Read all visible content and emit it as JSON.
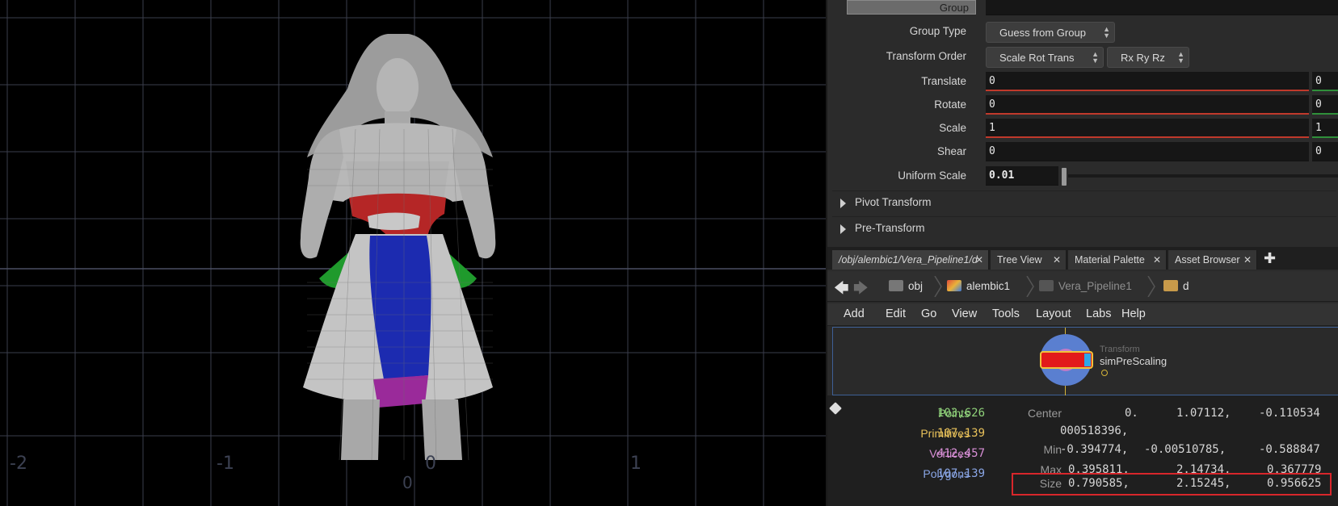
{
  "viewport": {
    "axis_labels": [
      "-2",
      "-1",
      "0",
      "1"
    ],
    "origin_marker": "0"
  },
  "parms": {
    "group_label": "Group",
    "group_type_label": "Group Type",
    "group_type_value": "Guess from Group",
    "transform_order_label": "Transform Order",
    "transform_order_value": "Scale Rot Trans",
    "rotation_order_value": "Rx Ry Rz",
    "translate_label": "Translate",
    "translate_x": "0",
    "translate_y": "0",
    "rotate_label": "Rotate",
    "rotate_x": "0",
    "rotate_y": "0",
    "scale_label": "Scale",
    "scale_x": "1",
    "scale_y": "1",
    "shear_label": "Shear",
    "shear_x": "0",
    "shear_y": "0",
    "uniform_scale_label": "Uniform Scale",
    "uniform_scale_value": "0.01",
    "folders": [
      "Pivot Transform",
      "Pre-Transform"
    ]
  },
  "tabs": [
    {
      "label": "/obj/alembic1/Vera_Pipeline1/d"
    },
    {
      "label": "Tree View"
    },
    {
      "label": "Material Palette"
    },
    {
      "label": "Asset Browser"
    }
  ],
  "path": {
    "obj": "obj",
    "alembic": "alembic1",
    "pipeline": "Vera_Pipeline1",
    "d": "d"
  },
  "menu": [
    "Add",
    "Edit",
    "Go",
    "View",
    "Tools",
    "Layout",
    "Labs",
    "Help"
  ],
  "node": {
    "type": "Transform",
    "name": "simPreScaling"
  },
  "info": {
    "points_label": "Points",
    "points_value": "103,626",
    "primitives_label": "Primitives",
    "primitives_value": "107,139",
    "vertices_label": "Vertices",
    "vertices_value": "412,457",
    "polygons_label": "Polygons",
    "polygons_value": "107,139",
    "center_label": "Center",
    "center_x": "0.",
    "center_x_cont": "000518396,",
    "center_y": "1.07112,",
    "center_z": "-0.110534",
    "min_label": "Min",
    "min_x": "-0.394774,",
    "min_y": "-0.00510785,",
    "min_z": "-0.588847",
    "max_label": "Max",
    "max_x": "0.395811,",
    "max_y": "2.14734,",
    "max_z": "0.367779",
    "size_label": "Size",
    "size_x": "0.790585,",
    "size_y": "2.15245,",
    "size_z": "0.956625"
  },
  "colors": {
    "points": "#8fd17a",
    "primitives": "#e8c15a",
    "vertices": "#d88fd6",
    "polygons": "#8aa6e6",
    "highlight": "#d8262b"
  }
}
